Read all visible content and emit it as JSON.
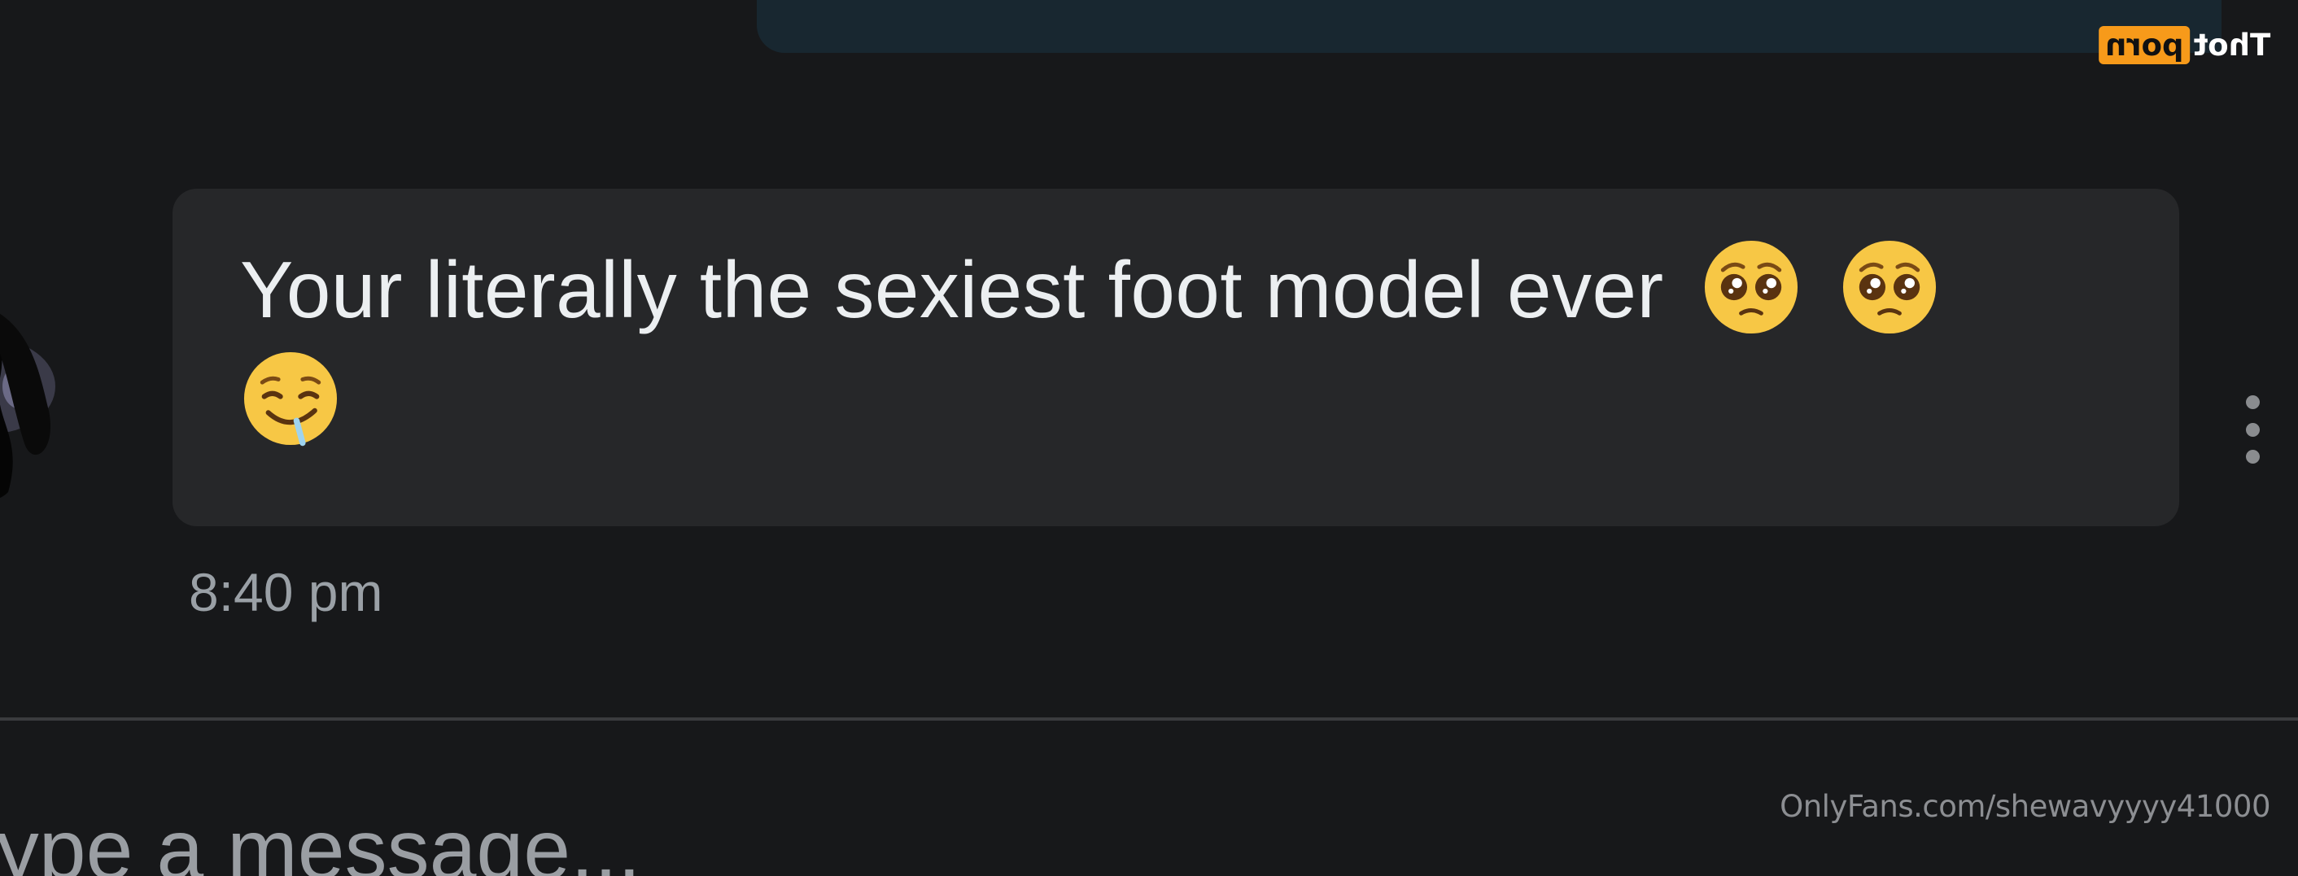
{
  "watermark": {
    "part_a": "Thot",
    "part_b": "porn",
    "accent_color": "#f79a1a"
  },
  "message": {
    "text": "Your literally the sexiest foot model ever",
    "emojis": [
      "pleading-face-emoji",
      "pleading-face-emoji",
      "drooling-face-emoji"
    ],
    "timestamp": "8:40 pm"
  },
  "composer": {
    "placeholder": "Type a message..."
  },
  "source_watermark": "OnlyFans.com/shewavyyyy41000",
  "colors": {
    "background": "#17181a",
    "bubble_incoming": "#262729",
    "bubble_outgoing": "#182730",
    "text": "#eceff1",
    "muted": "#9aa0a6"
  }
}
